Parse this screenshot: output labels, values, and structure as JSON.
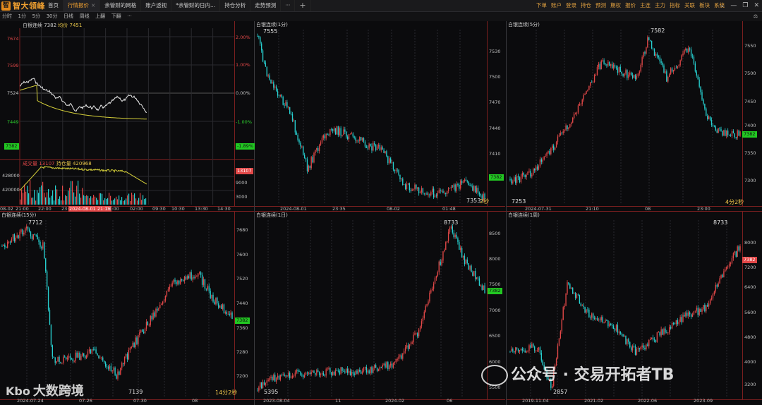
{
  "app": {
    "logo_glyph": "智",
    "name": "智大领峰"
  },
  "tabs": [
    {
      "label": "首页",
      "active": false,
      "closable": false
    },
    {
      "label": "行情报价",
      "active": true,
      "closable": true
    },
    {
      "label": "余管财的网格",
      "active": false,
      "closable": false
    },
    {
      "label": "账户透视",
      "active": false,
      "closable": false
    },
    {
      "label": "*余管财的日内...",
      "active": false,
      "closable": false
    },
    {
      "label": "持仓分析",
      "active": false,
      "closable": false
    },
    {
      "label": "走势预测",
      "active": false,
      "closable": false
    }
  ],
  "tab_more": "···",
  "tab_add": "+",
  "right_menu": [
    "下单",
    "账户",
    "登录",
    "持仓",
    "预测",
    "期权",
    "报价",
    "主连",
    "主力",
    "指标",
    "关联",
    "板块",
    "系统"
  ],
  "window_buttons": [
    "⌄",
    "—",
    "❐",
    "✕"
  ],
  "toolbar": [
    "分时",
    "1分",
    "5分",
    "30分",
    "日线",
    "周线",
    "上翻",
    "下翻",
    "···"
  ],
  "toolbar_right": "⚖",
  "panels": {
    "intraday": {
      "title": "白银连续 7382",
      "avg_label": "均价 7451",
      "left_ticks": [
        "7674",
        "7599",
        "7524",
        "7449",
        "7382"
      ],
      "right_ticks": [
        "2.00%",
        "1.00%",
        "0.00%",
        "-1.00%",
        "-1.89%"
      ],
      "price_tag": "7382",
      "pct_tag": "-1.89%",
      "vol_title": "成交量 13107",
      "oi_label": "持仓量 420968",
      "vol_left_ticks": [
        "428000",
        "420000"
      ],
      "vol_right_ticks": [
        "13107",
        "9000",
        "3000"
      ],
      "x_labels": [
        "08-02",
        "21:00",
        "22:00",
        "23:00",
        "2024-08-01 21:16",
        "01:00",
        "02:00",
        "09:30",
        "10:30",
        "13:30",
        "14:30"
      ]
    },
    "m1": {
      "title": "白银连续(1分)",
      "high": "7555",
      "low": "7353",
      "countdown": "2秒",
      "right_ticks": [
        "7530",
        "7500",
        "7470",
        "7440",
        "7410",
        "7380"
      ],
      "price_tag": "7382",
      "x_labels": [
        "2024-08-01",
        "23:35",
        "08-02",
        "01:48"
      ]
    },
    "m5": {
      "title": "白银连续(5分)",
      "high": "7582",
      "low": "7253",
      "countdown": "4分2秒",
      "right_ticks": [
        "7550",
        "7500",
        "7450",
        "7400",
        "7350",
        "7300"
      ],
      "price_tag": "7382",
      "x_labels": [
        "2024-07-31",
        "21:10",
        "08",
        "23:00"
      ]
    },
    "m15": {
      "title": "白银连续(15分)",
      "high": "7712",
      "low": "7139",
      "countdown": "14分2秒",
      "right_ticks": [
        "7680",
        "7600",
        "7520",
        "7440",
        "7360",
        "7280",
        "7200"
      ],
      "price_tag": "7382",
      "x_labels": [
        "2024-07-24",
        "07-26",
        "07-30",
        "08"
      ]
    },
    "d1": {
      "title": "白银连续(1日)",
      "high": "8733",
      "low": "5395",
      "right_ticks": [
        "8500",
        "8000",
        "7500",
        "7000",
        "6500",
        "6000",
        "5500"
      ],
      "price_tag": "7382",
      "x_labels": [
        "2023-08-04",
        "11",
        "2024-02",
        "06"
      ]
    },
    "w1": {
      "title": "白银连续(1周)",
      "high": "8733",
      "low": "2857",
      "right_ticks": [
        "8000",
        "7200",
        "6400",
        "5600",
        "4800",
        "4000",
        "3200"
      ],
      "price_tag": "7382",
      "x_labels": [
        "2019-11-04",
        "2021-02",
        "2022-06",
        "2023-09"
      ]
    }
  },
  "watermarks": {
    "wechat": "公众号 · 交易开拓者TB",
    "brand": "大数跨境",
    "brand_icon": "Kbo"
  },
  "colors": {
    "accent": "#f0a030",
    "up": "#e24848",
    "down": "#27d1d1",
    "price_green": "#22c822",
    "avg_line": "#d8d23a"
  }
}
